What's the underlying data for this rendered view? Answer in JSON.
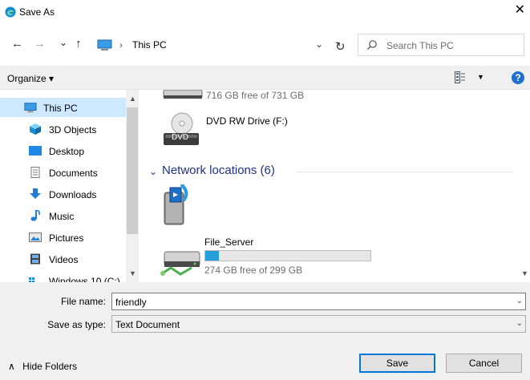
{
  "window": {
    "title": "Save As",
    "close_glyph": "✕"
  },
  "nav": {
    "back_glyph": "←",
    "forward_glyph": "→",
    "recent_glyph": "⌄",
    "up_glyph": "↑",
    "breadcrumb_sep": "›",
    "location": "This PC",
    "dropdown_glyph": "⌄",
    "refresh_glyph": "↻",
    "search_placeholder": "Search This PC"
  },
  "toolbar": {
    "organize": "Organize ▾",
    "view_dropdown": "▼",
    "help": "?"
  },
  "sidebar": {
    "items": [
      {
        "label": "This PC",
        "icon": "computer-icon",
        "selected": true
      },
      {
        "label": "3D Objects",
        "icon": "3d-objects-icon"
      },
      {
        "label": "Desktop",
        "icon": "desktop-icon"
      },
      {
        "label": "Documents",
        "icon": "documents-icon"
      },
      {
        "label": "Downloads",
        "icon": "downloads-icon"
      },
      {
        "label": "Music",
        "icon": "music-icon"
      },
      {
        "label": "Pictures",
        "icon": "pictures-icon"
      },
      {
        "label": "Videos",
        "icon": "videos-icon"
      },
      {
        "label": "Windows 10 (C:)",
        "icon": "drive-icon"
      }
    ],
    "scroll_up": "▲",
    "scroll_down": "▼"
  },
  "content": {
    "drive_top": {
      "free_text": "716 GB free of 731 GB"
    },
    "dvd": {
      "label": "DVD RW Drive (F:)",
      "icon_text": "DVD"
    },
    "network_header": "Network locations (6)",
    "network_chevron": "⌄",
    "file_server": {
      "label": "File_Server",
      "free_text": "274 GB free of 299 GB",
      "used_fraction": 0.084
    }
  },
  "footer": {
    "file_name_label": "File name:",
    "file_name_value": "friendly",
    "save_type_label": "Save as type:",
    "save_type_value": "Text Document",
    "dropdown_glyph": "⌄",
    "hide_folders": "Hide Folders",
    "hide_chevron": "∧",
    "save": "Save",
    "cancel": "Cancel"
  },
  "colors": {
    "accent": "#0078d7",
    "selection": "#cde8ff",
    "group_header": "#1e3287",
    "progress_fill": "#26a0da"
  }
}
